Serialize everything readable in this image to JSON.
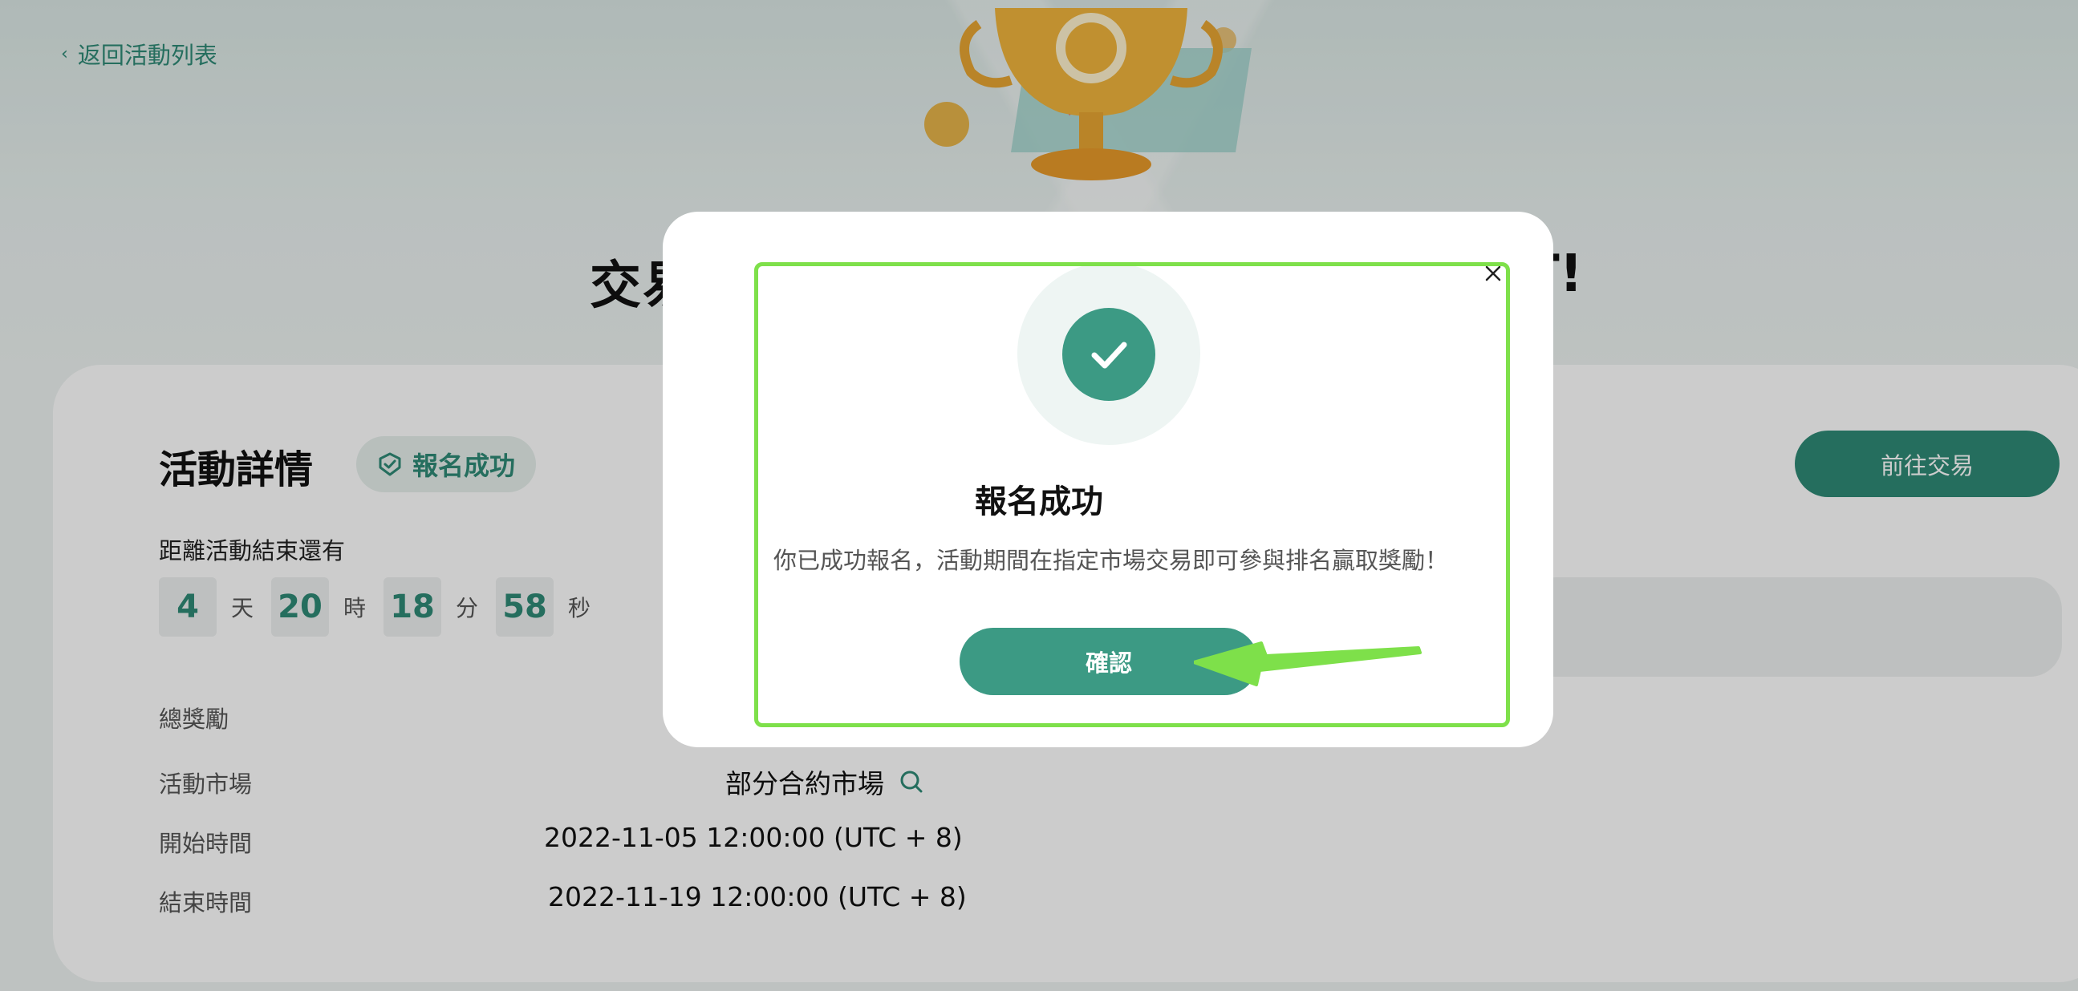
{
  "nav": {
    "back_label": "返回活動列表"
  },
  "hero": {
    "title_left": "交易",
    "title_right": "T!"
  },
  "details": {
    "section_title": "活動詳情",
    "status_badge": "報名成功",
    "trade_button": "前往交易",
    "countdown_label": "距離活動結束還有",
    "countdown": [
      {
        "value": "4",
        "unit": "天"
      },
      {
        "value": "20",
        "unit": "時"
      },
      {
        "value": "18",
        "unit": "分"
      },
      {
        "value": "58",
        "unit": "秒"
      }
    ],
    "total_reward_label": "總獎勵",
    "market_label": "活動市場",
    "market_value": "部分合約市場",
    "start_label": "開始時間",
    "start_value": "2022-11-05 12:00:00 (UTC + 8)",
    "end_label": "結束時間",
    "end_value": "2022-11-19 12:00:00 (UTC + 8)"
  },
  "modal": {
    "title": "報名成功",
    "description": "你已成功報名，活動期間在指定市場交易即可參與排名贏取獎勵！",
    "confirm_button": "確認"
  },
  "colors": {
    "brand_green": "#2f8a76",
    "modal_button": "#3c9a84",
    "highlight_annotation": "#7ee04a"
  },
  "icons": {
    "back": "chevron-left-icon",
    "status": "shield-check-icon",
    "market_search": "search-icon",
    "close": "close-icon",
    "success": "checkmark-icon",
    "annotation": "arrow-annotation"
  }
}
